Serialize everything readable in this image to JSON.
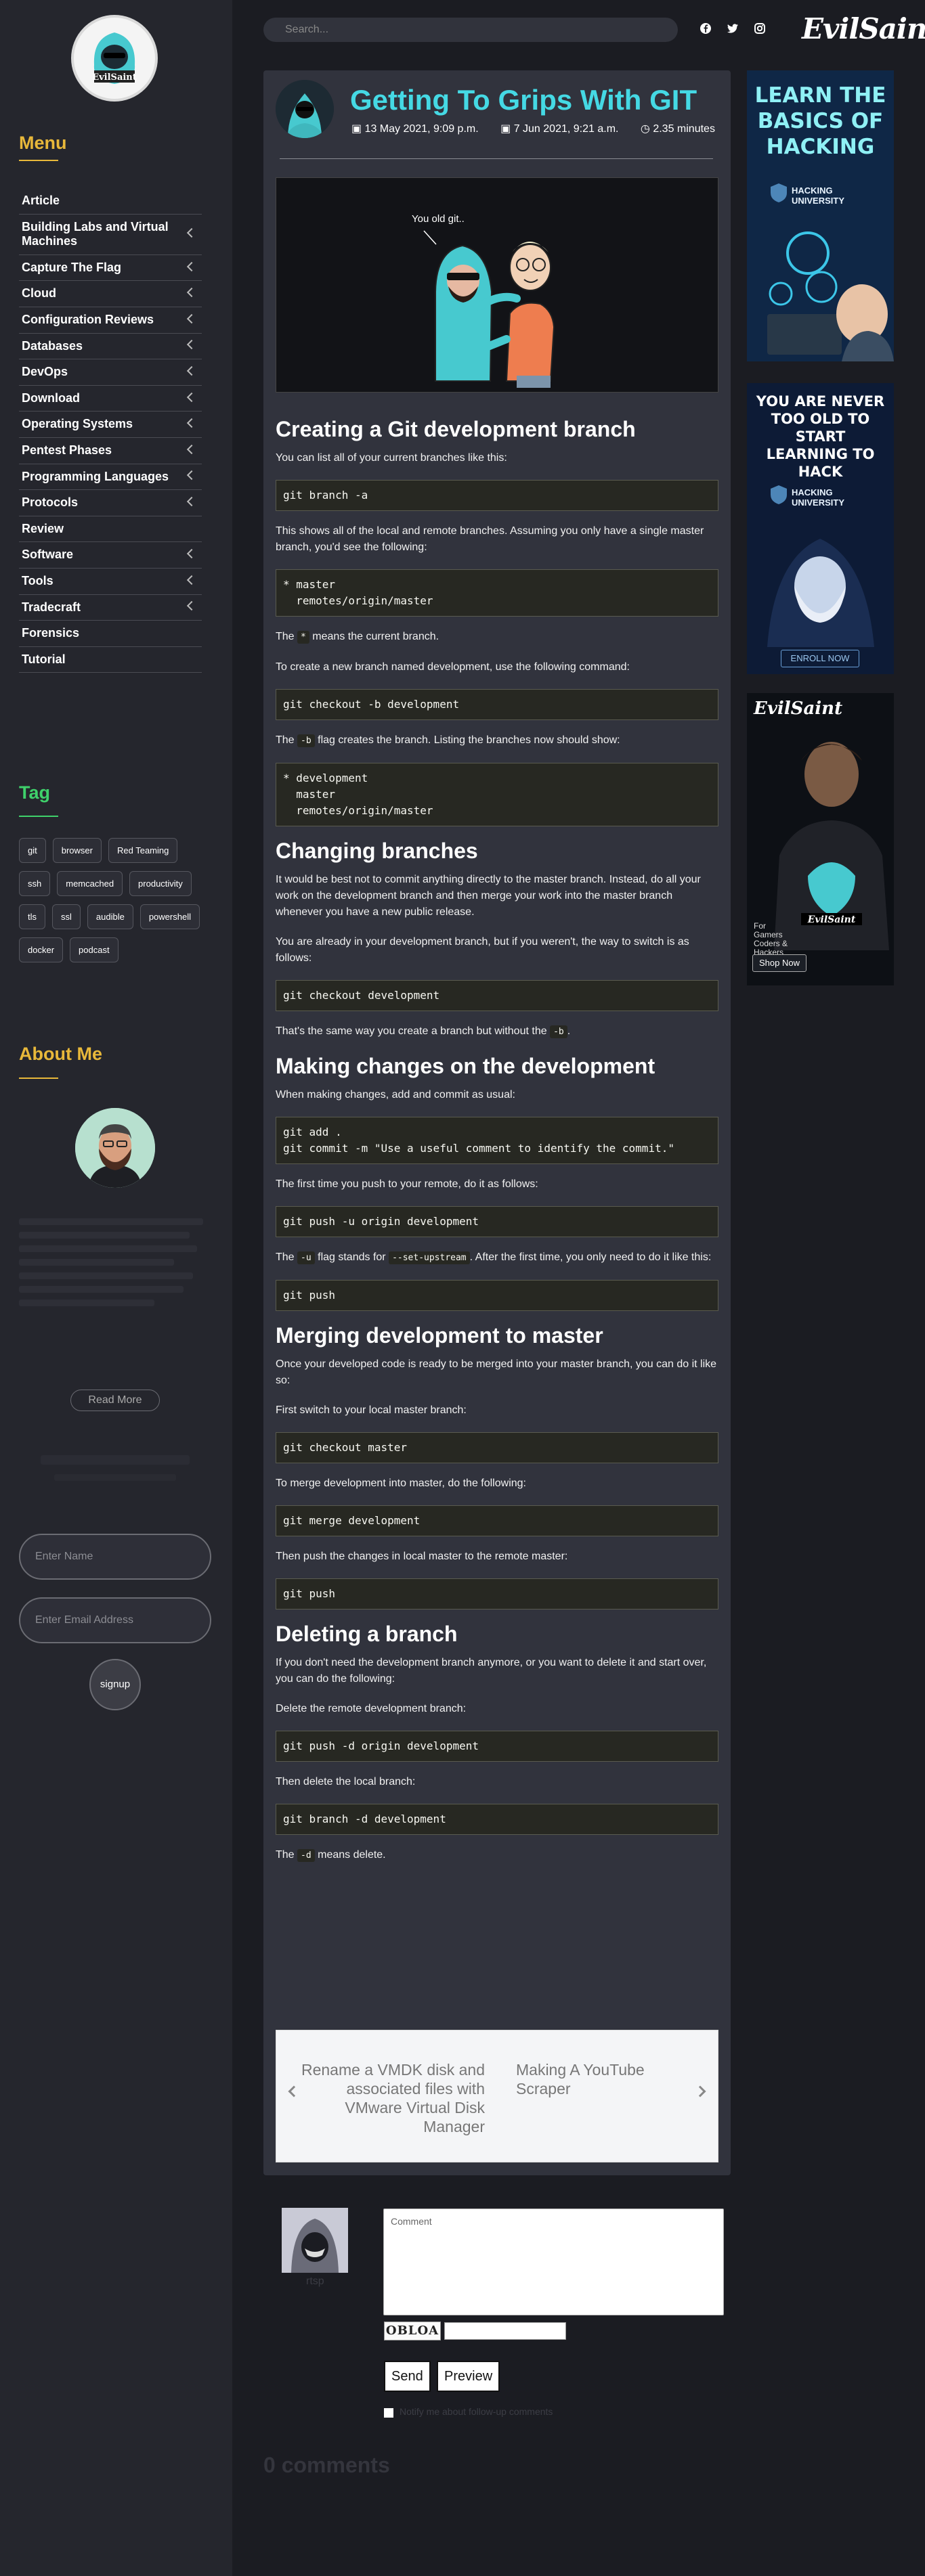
{
  "search": {
    "placeholder": "Search..."
  },
  "brand": {
    "name": "EvilSaint"
  },
  "social": [
    {
      "name": "facebook-icon",
      "glyph": "f"
    },
    {
      "name": "twitter-icon",
      "glyph": "t"
    },
    {
      "name": "instagram-icon",
      "glyph": "◎"
    }
  ],
  "sidebar": {
    "menu_title": "Menu",
    "menu": [
      {
        "label": "Article",
        "chevron": false
      },
      {
        "label": "Building Labs and Virtual Machines",
        "chevron": true
      },
      {
        "label": "Capture The Flag",
        "chevron": true
      },
      {
        "label": "Cloud",
        "chevron": true
      },
      {
        "label": "Configuration Reviews",
        "chevron": true
      },
      {
        "label": "Databases",
        "chevron": true
      },
      {
        "label": "DevOps",
        "chevron": true
      },
      {
        "label": "Download",
        "chevron": true
      },
      {
        "label": "Operating Systems",
        "chevron": true
      },
      {
        "label": "Pentest Phases",
        "chevron": true
      },
      {
        "label": "Programming Languages",
        "chevron": true
      },
      {
        "label": "Protocols",
        "chevron": true
      },
      {
        "label": "Review",
        "chevron": false
      },
      {
        "label": "Software",
        "chevron": true
      },
      {
        "label": "Tools",
        "chevron": true
      },
      {
        "label": "Tradecraft",
        "chevron": true
      },
      {
        "label": "Forensics",
        "chevron": false
      },
      {
        "label": "Tutorial",
        "chevron": false
      }
    ],
    "tag_title": "Tag",
    "tags": [
      "git",
      "browser",
      "Red Teaming",
      "ssh",
      "memcached",
      "productivity",
      "tls",
      "ssl",
      "audible",
      "powershell",
      "docker",
      "podcast"
    ],
    "about_title": "About Me",
    "read_more": "Read More",
    "name_placeholder": "Enter Name",
    "email_placeholder": "Enter Email Address",
    "signup": "signup"
  },
  "article": {
    "title": "Getting To Grips With GIT",
    "created": "13 May 2021, 9:09 p.m.",
    "updated": "7 Jun 2021, 9:21 a.m.",
    "read_time": "2.35 minutes",
    "hero_caption": "You old git..",
    "h_create": "Creating a Git development branch",
    "p_list": "You can list all of your current branches like this:",
    "code_branch_a": "git branch -a",
    "p_shows": "This shows all of the local and remote branches. Assuming you only have a single master branch, you'd see the following:",
    "code_master": "* master\n  remotes/origin/master",
    "p_star_pre": "The ",
    "code_star": "*",
    "p_star_post": " means the current branch.",
    "p_to_create": "To create a new branch named development, use the following command:",
    "code_checkout_b": "git checkout -b development",
    "p_bflag_pre": "The ",
    "code_bflag": "-b",
    "p_bflag_post": " flag creates the branch. Listing the branches now should show:",
    "code_dev_list": "* development\n  master\n  remotes/origin/master",
    "h_changing": "Changing branches",
    "p_best": "It would be best not to commit anything directly to the master branch. Instead, do all your work on the development branch and then merge your work into the master branch whenever you have a new public release.",
    "p_already": "You are already in your development branch, but if you weren't, the way to switch is as follows:",
    "code_checkout_dev": "git checkout development",
    "p_same_pre": "That's the same way you create a branch but without the ",
    "code_same": "-b",
    "p_same_post": ".",
    "h_making": "Making changes on the development",
    "p_making": "When making changes, add and commit as usual:",
    "code_add": "git add .\ngit commit -m \"Use a useful comment to identify the commit.\"",
    "p_first": "The first time you push to your remote, do it as follows:",
    "code_push_u": "git push -u origin development",
    "p_uflag_pre": "The ",
    "code_uflag": "-u",
    "p_uflag_mid": " flag stands for ",
    "code_setup": "--set-upstream",
    "p_uflag_post": ". After the first time, you only need to do it like this:",
    "code_push": "git push",
    "h_merging": "Merging development to master",
    "p_once": "Once your developed code is ready to be merged into your master branch, you can do it like so:",
    "p_first_switch": "First switch to your local master branch:",
    "code_checkout_master": "git checkout master",
    "p_to_merge": "To merge development into master, do the following:",
    "code_merge": "git merge development",
    "p_then_push": "Then push the changes in local master to the remote master:",
    "code_push2": "git push",
    "h_deleting": "Deleting a branch",
    "p_dont_need": "If you don't need the development branch anymore, or you want to delete it and start over, you can do the following:",
    "p_delete_remote": "Delete the remote development branch:",
    "code_push_d": "git push -d origin development",
    "p_then_delete": "Then delete the local branch:",
    "code_branch_d": "git branch -d development",
    "p_dflag_pre": "The ",
    "code_dflag": "-d",
    "p_dflag_post": " means delete.",
    "prev": "Rename a VMDK disk and associated files with VMware Virtual Disk Manager",
    "next": "Making A YouTube Scraper"
  },
  "ads": {
    "ad1_head": "LEARN THE BASICS OF HACKING",
    "ad1_sub": "HACKING UNIVERSITY",
    "ad2_head": "YOU ARE NEVER TOO OLD TO START LEARNING TO HACK",
    "ad2_sub": "HACKING UNIVERSITY",
    "ad2_btn": "ENROLL NOW",
    "ad3_brand": "EvilSaint",
    "ad3_text": "For Gamers Coders & Hackers",
    "ad3_btn": "Shop Now"
  },
  "comments": {
    "user": "rtsp",
    "placeholder": "Comment",
    "captcha": "OBLOA",
    "send": "Send",
    "preview": "Preview",
    "notify": "Notify me about follow-up comments",
    "count": "0 comments"
  }
}
